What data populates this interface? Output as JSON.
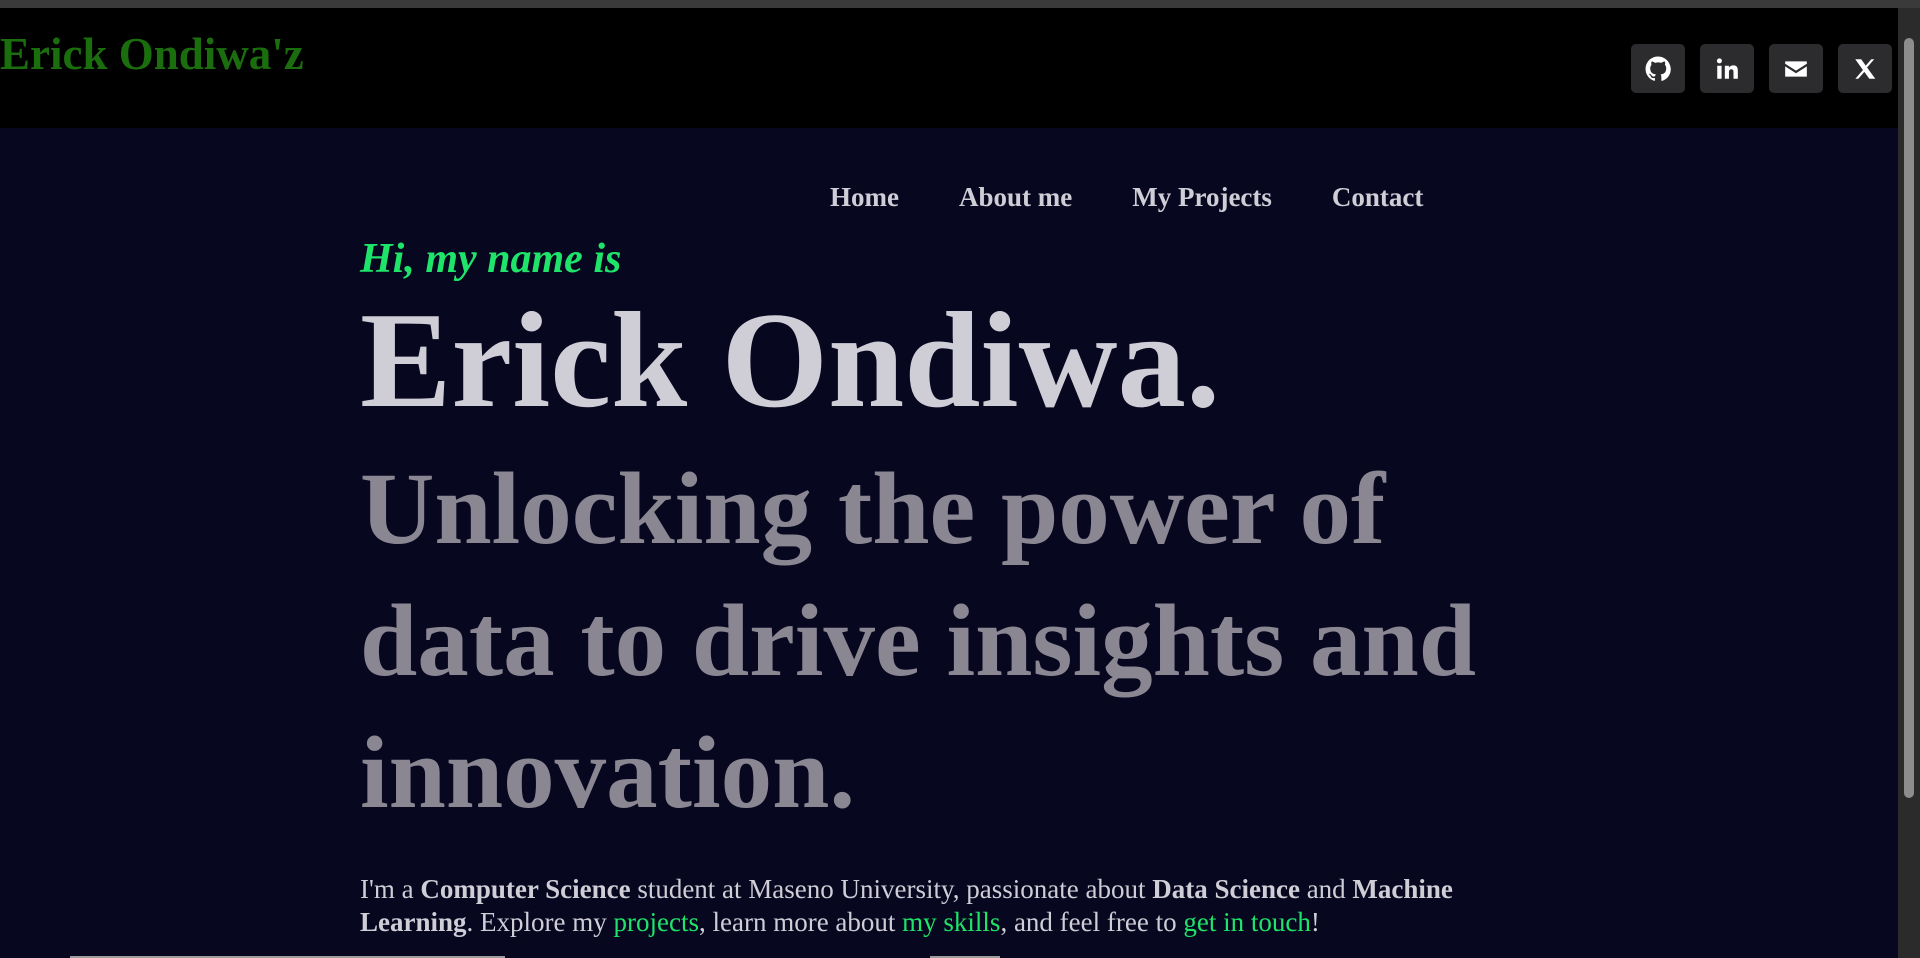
{
  "header": {
    "brand": "Erick Ondiwa'z",
    "socials": [
      {
        "icon": "github-icon"
      },
      {
        "icon": "linkedin-icon"
      },
      {
        "icon": "email-icon"
      },
      {
        "icon": "x-twitter-icon"
      }
    ]
  },
  "nav": {
    "items": [
      {
        "label": "Home"
      },
      {
        "label": "About me"
      },
      {
        "label": "My Projects"
      },
      {
        "label": "Contact"
      }
    ]
  },
  "hero": {
    "greeting": "Hi, my name is",
    "name": "Erick Ondiwa.",
    "tagline": "Unlocking the power of data to drive insights and innovation."
  },
  "intro": {
    "t1": "I'm a ",
    "b1": "Computer Science",
    "t2": " student at Maseno University, passionate about ",
    "b2": "Data Science",
    "t3": " and ",
    "b3": "Machine Learning",
    "t4": ". Explore my ",
    "link_projects": "projects",
    "t5": ", learn more about ",
    "link_skills": "my skills",
    "t6": ", and feel free to ",
    "link_contact": "get in touch",
    "t7": "!"
  },
  "colors": {
    "background": "#070720",
    "header_bg": "#000000",
    "brand": "#1b6e0d",
    "accent": "#1ee56a",
    "text": "#cfcdd6",
    "muted": "#8a8793"
  }
}
